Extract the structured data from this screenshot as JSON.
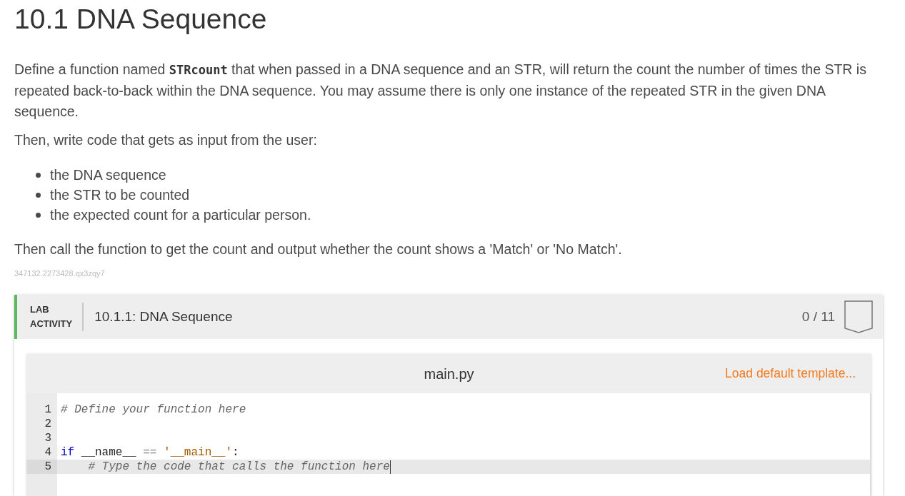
{
  "heading": "10.1 DNA Sequence",
  "paragraphs": [
    "Define a function named **STRcount** that when passed in a DNA sequence and an STR, will return the count the number of times the STR is repeated back-to-back within the DNA sequence. You may assume there is only one instance of the repeated STR in the given DNA sequence.",
    "Then, write code that gets as input from the user:"
  ],
  "bullets": [
    "the DNA sequence",
    "the STR to be counted",
    "the expected count for a particular person."
  ],
  "closing": "Then call the function to get the count and output whether the count shows a 'Match' or 'No Match'.",
  "content_id": "347132.2273428.qx3zqy7",
  "lab_activity": {
    "label": "LAB ACTIVITY",
    "title": "10.1.1: DNA Sequence",
    "score": "0 / 11",
    "editor": {
      "filename": "main.py",
      "template_link": "Load default template...",
      "lines": [
        {
          "number": "1",
          "active": false,
          "tokens": [
            {
              "kind": "comment",
              "text": "# Define your function here"
            }
          ]
        },
        {
          "number": "2",
          "active": false
        },
        {
          "number": "3",
          "active": false
        },
        {
          "number": "4",
          "active": false,
          "tokens": [
            {
              "kind": "keyword",
              "text": "if "
            },
            {
              "kind": "plain",
              "text": "__name__ "
            },
            {
              "kind": "operator",
              "text": "== "
            },
            {
              "kind": "string",
              "text": "'__main__'"
            },
            {
              "kind": "plain",
              "text": ":"
            }
          ]
        },
        {
          "number": "5",
          "active": true,
          "tokens": [
            {
              "kind": "comment",
              "text": "    # Type the code that calls the function here"
            }
          ]
        }
      ]
    }
  }
}
